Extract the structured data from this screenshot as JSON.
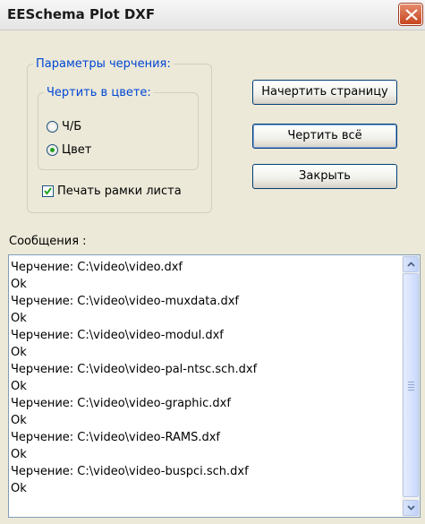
{
  "window": {
    "title": "EESchema Plot DXF"
  },
  "plot_options": {
    "legend": "Параметры черчения:",
    "color_group": {
      "legend": "Чертить в цвете:",
      "options": [
        {
          "label": "Ч/Б",
          "checked": false
        },
        {
          "label": "Цвет",
          "checked": true
        }
      ]
    },
    "print_frame": {
      "label": "Печать рамки листа",
      "checked": true
    }
  },
  "buttons": {
    "draw_page": "Начертить страницу",
    "draw_all": "Чертить всё",
    "close": "Закрыть"
  },
  "messages": {
    "label": "Сообщения :",
    "lines": [
      "Черчение: C:\\video\\video.dxf",
      "Ok",
      "Черчение: C:\\video\\video-muxdata.dxf",
      "Ok",
      "Черчение: C:\\video\\video-modul.dxf",
      "Ok",
      "Черчение: C:\\video\\video-pal-ntsc.sch.dxf",
      "Ok",
      "Черчение: C:\\video\\video-graphic.dxf",
      "Ok",
      "Черчение: C:\\video\\video-RAMS.dxf",
      "Ok",
      "Черчение: C:\\video\\video-buspci.sch.dxf",
      "Ok"
    ]
  },
  "icons": {
    "close": "close-icon",
    "scroll_up": "arrow-up-icon",
    "scroll_down": "arrow-down-icon",
    "check": "checkmark-icon"
  },
  "colors": {
    "legend_text": "#0046d5",
    "close_button": "#c6451f",
    "radio_dot": "#21a121",
    "check_mark": "#21a121"
  }
}
